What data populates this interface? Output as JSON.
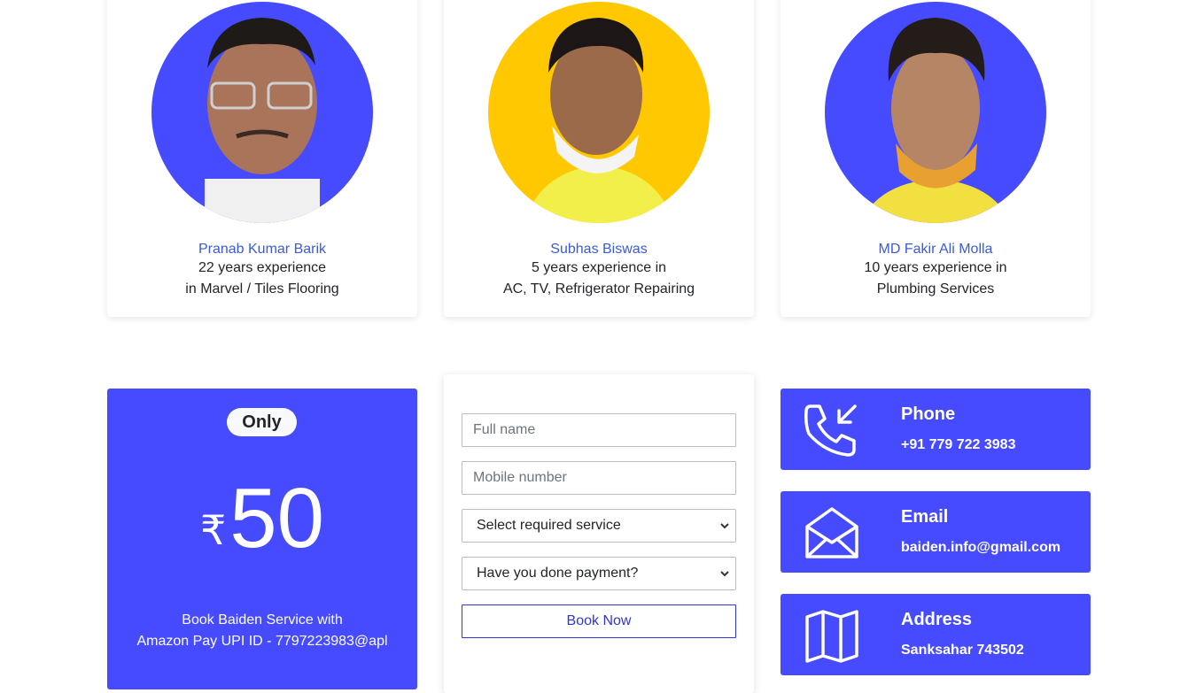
{
  "team": [
    {
      "name": "Pranab Kumar Barik",
      "line1": "22 years experience",
      "line2": "in Marvel / Tiles Flooring",
      "bg_color": "#464bff"
    },
    {
      "name": "Subhas Biswas",
      "line1": "5 years experience in",
      "line2": "AC, TV, Refrigerator Repairing",
      "bg_color": "#ffc800"
    },
    {
      "name": "MD Fakir Ali Molla",
      "line1": "10 years experience in",
      "line2": "Plumbing Services",
      "bg_color": "#464bff"
    }
  ],
  "price_panel": {
    "badge": "Only",
    "currency": "₹",
    "amount": "50",
    "info_line1": "Book Baiden Service with",
    "info_line2": "Amazon Pay UPI ID - 7797223983@apl"
  },
  "form": {
    "name_placeholder": "Full name",
    "mobile_placeholder": "Mobile number",
    "service_select": "Select required service",
    "payment_select": "Have you done payment?",
    "submit_label": "Book Now"
  },
  "contact": {
    "phone": {
      "title": "Phone",
      "value": "+91 779 722 3983",
      "icon": "phone-incoming-icon"
    },
    "email": {
      "title": "Email",
      "value": "baiden.info@gmail.com",
      "icon": "envelope-open-icon"
    },
    "address": {
      "title": "Address",
      "value": "Sanksahar 743502",
      "icon": "map-icon"
    }
  },
  "colors": {
    "brand": "#464bff",
    "name_link": "#3b5bdb",
    "accent_yellow": "#ffc800"
  }
}
